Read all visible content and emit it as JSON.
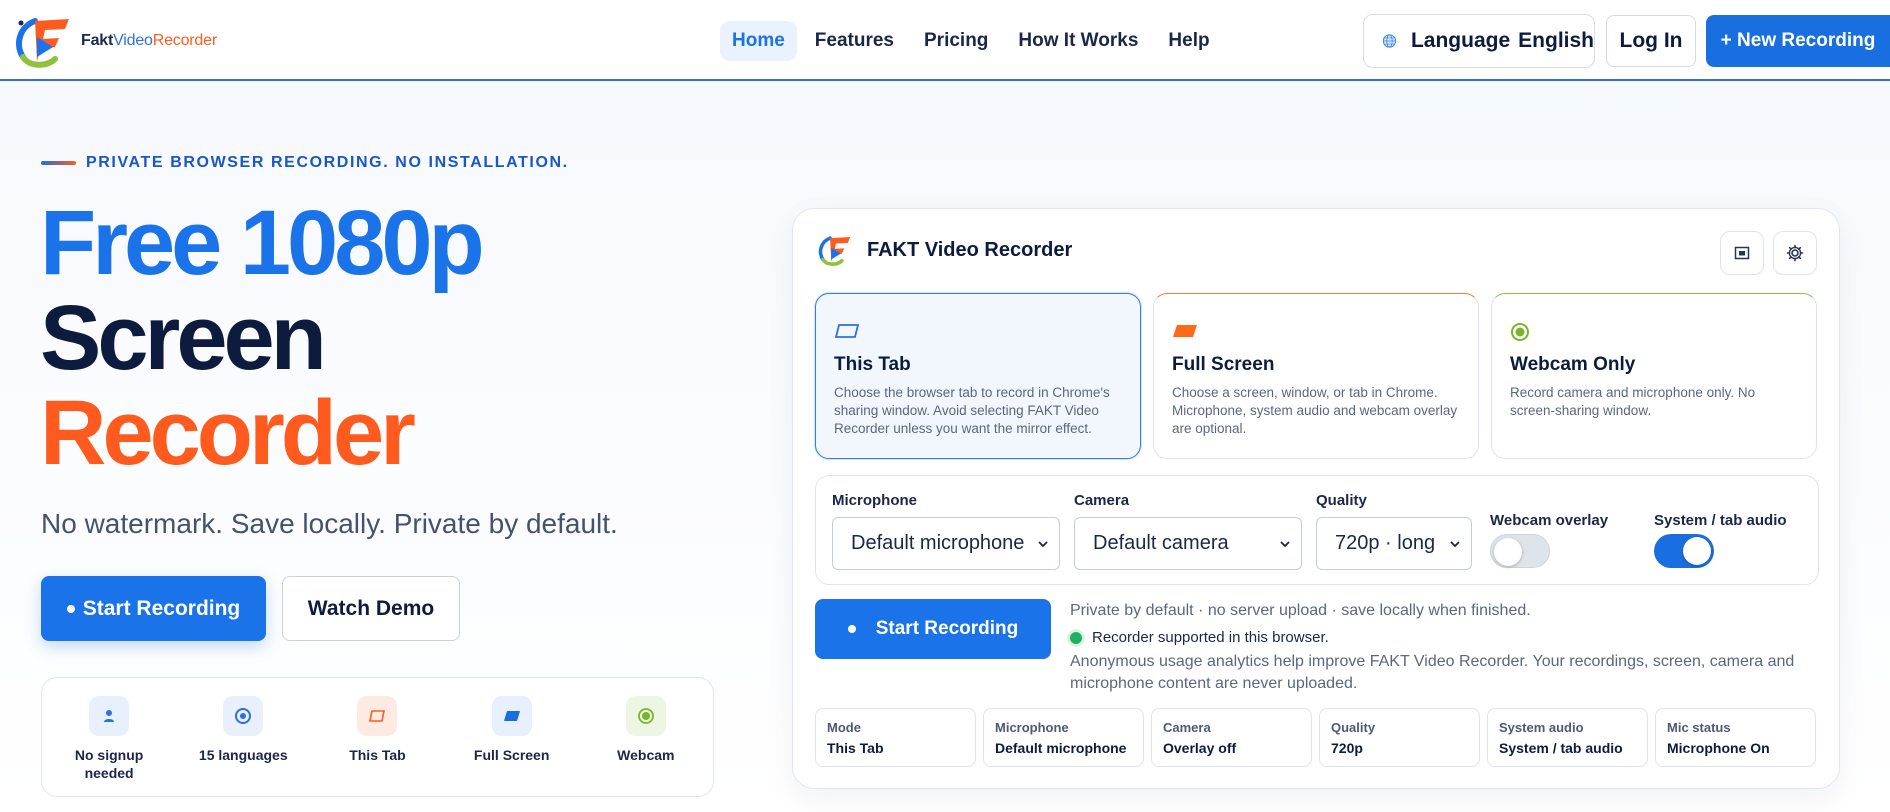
{
  "brand": {
    "part1": "Fakt",
    "part2": "Video",
    "part3": "Recorder"
  },
  "nav": {
    "items": [
      {
        "label": "Home",
        "active": true
      },
      {
        "label": "Features"
      },
      {
        "label": "Pricing"
      },
      {
        "label": "How It Works"
      },
      {
        "label": "Help"
      }
    ],
    "language_label": "Language",
    "language_value": "English",
    "login": "Log In",
    "new_recording": "+ New Recording"
  },
  "hero": {
    "eyebrow": "PRIVATE BROWSER RECORDING. NO INSTALLATION.",
    "title_line1": "Free 1080p",
    "title_line2": "Screen",
    "title_line3": "Recorder",
    "subtitle": "No watermark. Save locally. Private by default.",
    "cta_primary": "Start Recording",
    "cta_secondary": "Watch Demo"
  },
  "features": [
    {
      "label": "No signup needed",
      "icon": "person-icon"
    },
    {
      "label": "15 languages",
      "icon": "target-icon"
    },
    {
      "label": "This Tab",
      "icon": "tab-icon"
    },
    {
      "label": "Full Screen",
      "icon": "screen-icon"
    },
    {
      "label": "Webcam",
      "icon": "webcam-icon"
    }
  ],
  "panel": {
    "title": "FAKT Video Recorder",
    "modes": [
      {
        "title": "This Tab",
        "desc": "Choose the browser tab to record in Chrome's sharing window. Avoid selecting FAKT Video Recorder unless you want the mirror effect.",
        "selected": true
      },
      {
        "title": "Full Screen",
        "desc": "Choose a screen, window, or tab in Chrome. Microphone, system audio and webcam overlay are optional."
      },
      {
        "title": "Webcam Only",
        "desc": "Record camera and microphone only. No screen-sharing window."
      }
    ],
    "settings": {
      "microphone_label": "Microphone",
      "microphone_value": "Default microphone",
      "camera_label": "Camera",
      "camera_value": "Default camera",
      "quality_label": "Quality",
      "quality_value": "720p · long",
      "webcam_overlay_label": "Webcam overlay",
      "webcam_overlay_on": false,
      "system_audio_label": "System / tab audio",
      "system_audio_on": true
    },
    "start_button": "Start Recording",
    "privacy_note": "Private by default · no server upload · save locally when finished.",
    "supported_note": "Recorder supported in this browser.",
    "analytics_note": "Anonymous usage analytics help improve FAKT Video Recorder. Your recordings, screen, camera and microphone content are never uploaded.",
    "stats": [
      {
        "label": "Mode",
        "value": "This Tab"
      },
      {
        "label": "Microphone",
        "value": "Default microphone"
      },
      {
        "label": "Camera",
        "value": "Overlay off"
      },
      {
        "label": "Quality",
        "value": "720p"
      },
      {
        "label": "System audio",
        "value": "System / tab audio"
      },
      {
        "label": "Mic status",
        "value": "Microphone On"
      }
    ]
  },
  "colors": {
    "primary": "#1a73e8",
    "accent": "#ff5b1f",
    "navy": "#0d1b3e",
    "success": "#22b066"
  }
}
